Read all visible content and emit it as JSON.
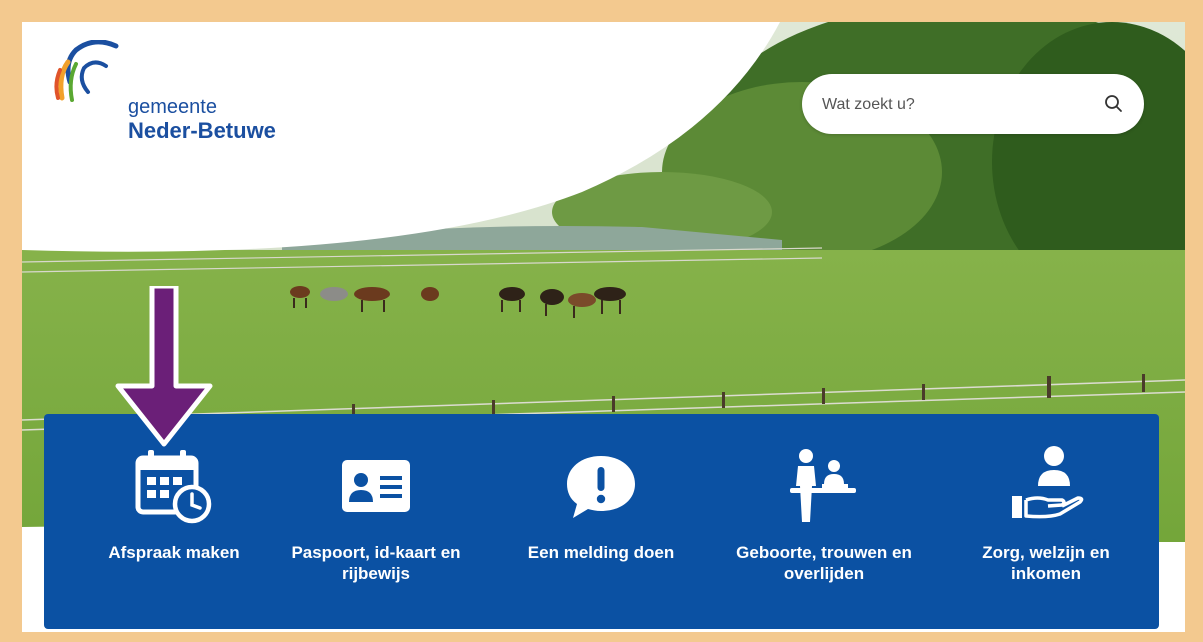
{
  "brand": {
    "line1": "gemeente",
    "line2": "Neder-Betuwe"
  },
  "search": {
    "placeholder": "Wat zoekt u?",
    "icon": "search-icon"
  },
  "tiles": [
    {
      "label": "Afspraak maken",
      "icon": "calendar-clock-icon"
    },
    {
      "label": "Paspoort, id-kaart en rijbewijs",
      "icon": "id-card-icon"
    },
    {
      "label": "Een melding doen",
      "icon": "exclamation-bubble-icon"
    },
    {
      "label": "Geboorte, trouwen en overlijden",
      "icon": "people-desk-icon"
    },
    {
      "label": "Zorg, welzijn en inkomen",
      "icon": "person-hand-icon"
    }
  ],
  "colors": {
    "panel": "#0b51a3",
    "brand_blue": "#1b4fa0",
    "frame": "#f3c98f",
    "arrow": "#6b1f78"
  }
}
